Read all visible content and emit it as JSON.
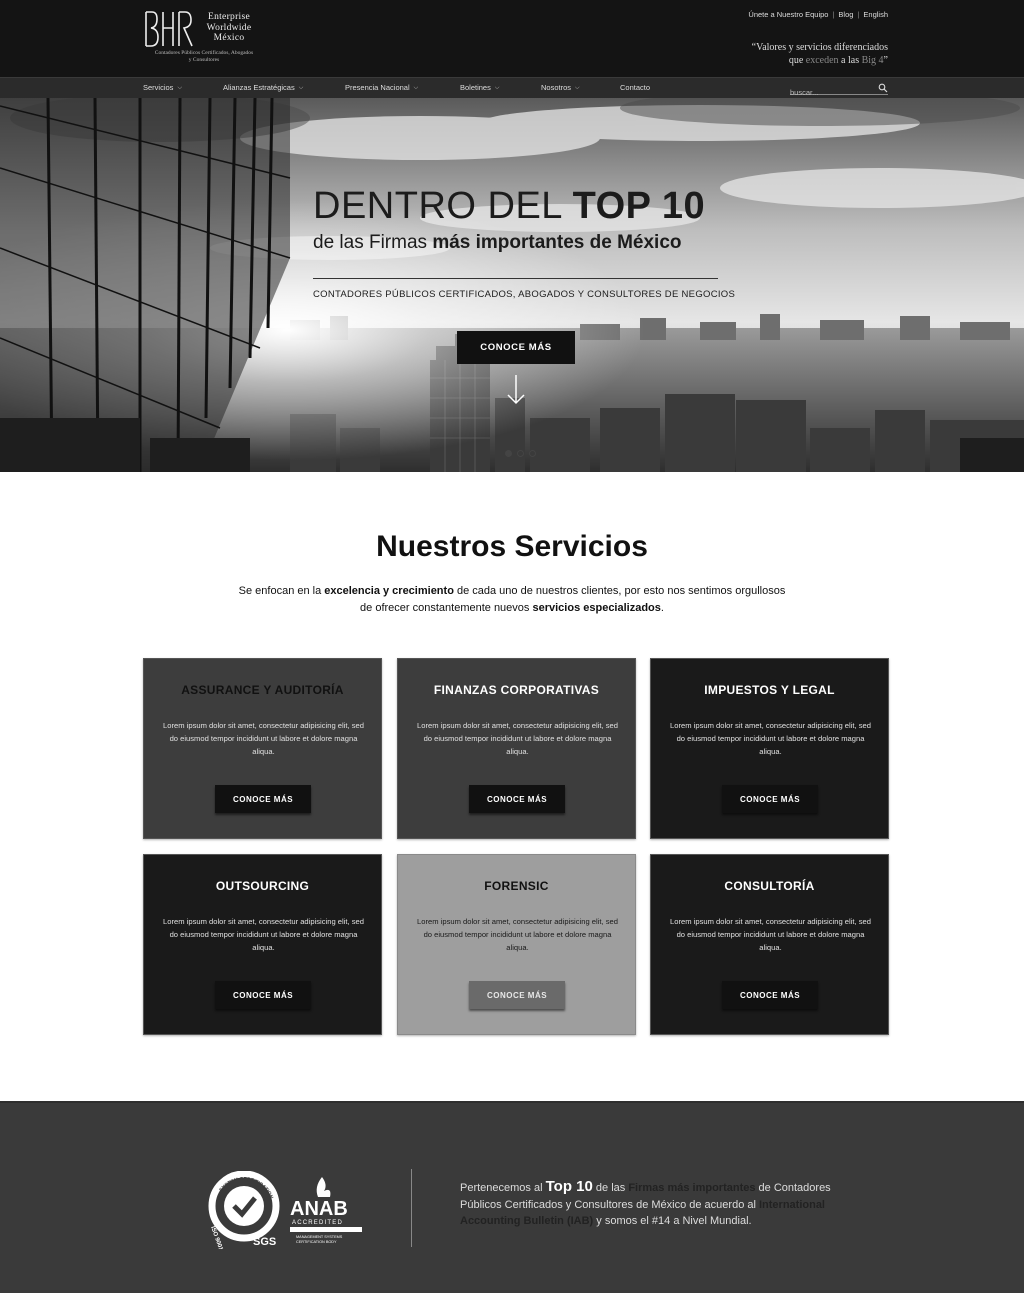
{
  "header": {
    "logo": {
      "mark": "BHR",
      "name_lines": [
        "Enterprise",
        "Worldwide",
        "México"
      ],
      "subtitle_lines": [
        "Contadores Públicos Certificados, Abogados",
        "y Consultores"
      ]
    },
    "top_links": [
      "Únete a Nuestro Equipo",
      "Blog",
      "English"
    ],
    "tagline": {
      "line1": "“Valores y servicios diferenciados",
      "line2_a": "que ",
      "line2_b": "exceden",
      "line2_c": " a las ",
      "line2_d": "Big 4",
      "line2_e": "”"
    }
  },
  "nav": {
    "items": [
      {
        "label": "Servicios",
        "has_dropdown": true
      },
      {
        "label": "Alianzas Estratégicas",
        "has_dropdown": true
      },
      {
        "label": "Presencia Nacional",
        "has_dropdown": true
      },
      {
        "label": "Boletines",
        "has_dropdown": true
      },
      {
        "label": "Nosotros",
        "has_dropdown": true
      },
      {
        "label": "Contacto",
        "has_dropdown": false
      }
    ],
    "search_placeholder": "buscar..."
  },
  "hero": {
    "title_light": "DENTRO DEL ",
    "title_bold": "TOP 10",
    "subtitle_light": "de las Firmas ",
    "subtitle_bold": "más importantes de México",
    "small": "CONTADORES PÚBLICOS CERTIFICADOS, ABOGADOS Y CONSULTORES DE NEGOCIOS",
    "button": "CONOCE MÁS",
    "slides_count": 3,
    "active_slide": 1
  },
  "services": {
    "title": "Nuestros Servicios",
    "intro": {
      "p1": "Se enfocan en la ",
      "b1": "excelencia y crecimiento",
      "p2": " de cada uno de nuestros clientes, por esto nos sentimos orgullosos de ofrecer constantemente nuevos ",
      "b2": "servicios especializados",
      "p3": "."
    },
    "cards": [
      {
        "title": "ASSURANCE Y AUDITORÍA",
        "text": "Lorem ipsum dolor sit amet, consectetur adipisicing elit, sed do eiusmod tempor incididunt ut labore et dolore magna aliqua.",
        "button": "CONOCE MÁS"
      },
      {
        "title": "FINANZAS CORPORATIVAS",
        "text": "Lorem ipsum dolor sit amet, consectetur adipisicing elit, sed do eiusmod tempor incididunt ut labore et dolore magna aliqua.",
        "button": "CONOCE MÁS"
      },
      {
        "title": "IMPUESTOS Y LEGAL",
        "text": "Lorem ipsum dolor sit amet, consectetur adipisicing elit, sed do eiusmod tempor incididunt ut labore et dolore magna aliqua.",
        "button": "CONOCE MÁS"
      },
      {
        "title": "OUTSOURCING",
        "text": "Lorem ipsum dolor sit amet, consectetur adipisicing elit, sed do eiusmod tempor incididunt ut labore et dolore magna aliqua.",
        "button": "CONOCE MÁS"
      },
      {
        "title": "FORENSIC",
        "text": "Lorem ipsum dolor sit amet, consectetur adipisicing elit, sed do eiusmod tempor incididunt ut labore et dolore magna aliqua.",
        "button": "CONOCE MÁS"
      },
      {
        "title": "CONSULTORÍA",
        "text": "Lorem ipsum dolor sit amet, consectetur adipisicing elit, sed do eiusmod tempor incididunt ut labore et dolore magna aliqua.",
        "button": "CONOCE MÁS"
      }
    ]
  },
  "footer": {
    "iso_logo": {
      "top": "SYSTEM CERTIFICATION",
      "side": "ISO 9001",
      "bottom": "SGS"
    },
    "anab_logo": {
      "name": "ANAB",
      "line1": "ACCREDITED",
      "line2": "MANAGEMENT SYSTEMS",
      "line3": "CERTIFICATION BODY"
    },
    "text": {
      "p1": "Pertenecemos al ",
      "big": "Top 10",
      "p2": " de las ",
      "d1": "Firmas más importantes",
      "p3": " de Contadores Públicos Certificados y Consultores de México de acuerdo al ",
      "d2": "International Accounting Bulletin (IAB)",
      "p4": " y somos el #14 a Nivel Mundial."
    }
  },
  "colors": {
    "header_bg": "#141414",
    "nav_bg": "#2b2b2b",
    "card_dark": "#1a1a1a",
    "card_mid": "#3d3d3d",
    "card_light": "#9e9e9e",
    "footer_bg": "#3a3a3a"
  }
}
